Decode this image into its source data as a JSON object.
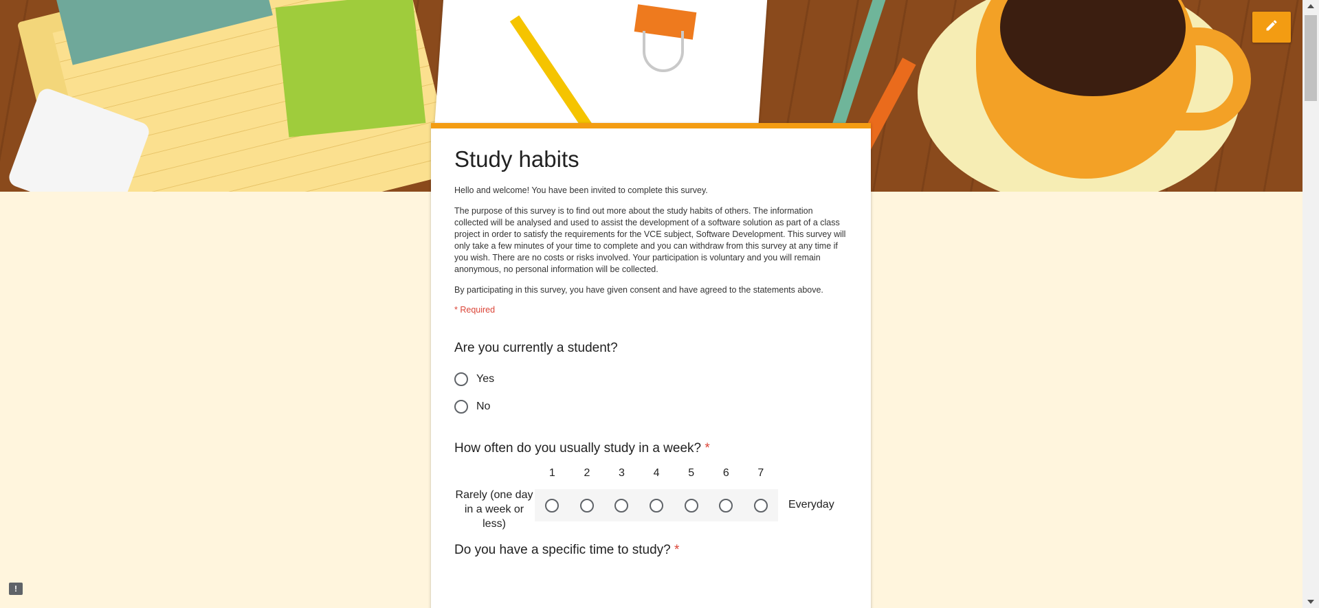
{
  "form": {
    "title": "Study habits",
    "description": [
      "Hello and welcome! You have been invited to complete this survey.",
      "The purpose of this survey is to find out more about the study habits of others. The information collected will be analysed and used to assist the development of a software solution as part of a class project in order to satisfy the requirements for the VCE subject, Software Development. This survey will only take a few minutes of your time to complete and you can withdraw from this survey at any time if you wish. There are no costs or risks involved. Your participation is voluntary and you will remain anonymous, no personal information will be collected.",
      "By participating in this survey, you have given consent and have agreed to the statements above."
    ],
    "required_note": "* Required",
    "questions": [
      {
        "title": "Are you currently a student?",
        "required": false,
        "options": [
          "Yes",
          "No"
        ]
      },
      {
        "title": "How often do you usually study in a week?",
        "required": true,
        "required_mark": "*",
        "scale": [
          "1",
          "2",
          "3",
          "4",
          "5",
          "6",
          "7"
        ],
        "low_label": "Rarely (one day in a week or less)",
        "high_label": "Everyday"
      },
      {
        "title": "Do you have a specific time to study?",
        "required": true,
        "required_mark": "*"
      }
    ]
  },
  "icons": {
    "edit": "pencil-icon",
    "report": "report-problem-icon",
    "report_glyph": "!"
  },
  "colors": {
    "accent": "#f39c12",
    "background": "#fff5dd",
    "required": "#db4437"
  }
}
